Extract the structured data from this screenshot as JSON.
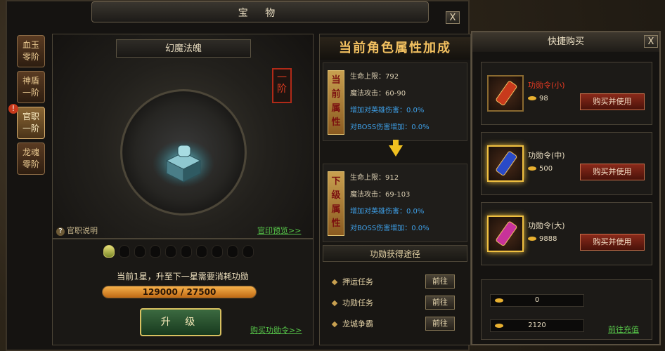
{
  "window": {
    "title": "宝 物",
    "close": "X"
  },
  "tabs": [
    {
      "label_1": "血玉",
      "label_2": "零阶"
    },
    {
      "label_1": "神盾",
      "label_2": "一阶"
    },
    {
      "label_1": "官职",
      "label_2": "一阶",
      "alert": "!"
    },
    {
      "label_1": "龙魂",
      "label_2": "零阶"
    }
  ],
  "artifact": {
    "name": "幻魔法魄",
    "rank": "一阶",
    "help": "官职说明",
    "help_icon": "?",
    "preview_link": "官印预览>>"
  },
  "upgrade": {
    "stars_lit": 1,
    "stars_total": 10,
    "cost_text": "当前1星，升至下一星需要消耗功勋",
    "progress_text": "129000 / 27500",
    "progress_fraction": 1.0,
    "button": "升 级",
    "buy_link": "购买功勋令>>"
  },
  "attributes": {
    "title": "当前角色属性加成",
    "current": {
      "badge": "当前属性",
      "lines": [
        {
          "label": "生命上限：792",
          "color": "#d8ccb0"
        },
        {
          "label": "魔法攻击：60-90",
          "color": "#d8ccb0"
        },
        {
          "label": "增加对英雄伤害：0.0%",
          "color": "#3ea0e8"
        },
        {
          "label": "对BOSS伤害增加：0.0%",
          "color": "#3ea0e8"
        }
      ]
    },
    "next": {
      "badge": "下级属性",
      "lines": [
        {
          "label": "生命上限：912",
          "color": "#d8ccb0"
        },
        {
          "label": "魔法攻击：69-103",
          "color": "#d8ccb0"
        },
        {
          "label": "增加对英雄伤害：0.0%",
          "color": "#3ea0e8"
        },
        {
          "label": "对BOSS伤害增加：0.0%",
          "color": "#3ea0e8"
        }
      ]
    }
  },
  "routes": {
    "title": "功勋获得途径",
    "items": [
      {
        "label": "押运任务",
        "button": "前往"
      },
      {
        "label": "功勋任务",
        "button": "前往"
      },
      {
        "label": "龙城争霸",
        "button": "前往"
      }
    ]
  },
  "quick_buy": {
    "title": "快捷购买",
    "close": "X",
    "items": [
      {
        "name": "功勋令(小)",
        "price": "98",
        "button": "购买并使用",
        "icon": "merit-token-small-icon"
      },
      {
        "name": "功勋令(中)",
        "price": "500",
        "button": "购买并使用",
        "icon": "merit-token-medium-icon"
      },
      {
        "name": "功勋令(大)",
        "price": "9888",
        "button": "购买并使用",
        "icon": "merit-token-large-icon"
      }
    ],
    "wallet": {
      "gold": "0",
      "ingot": "2120",
      "recharge": "前往充值"
    }
  }
}
